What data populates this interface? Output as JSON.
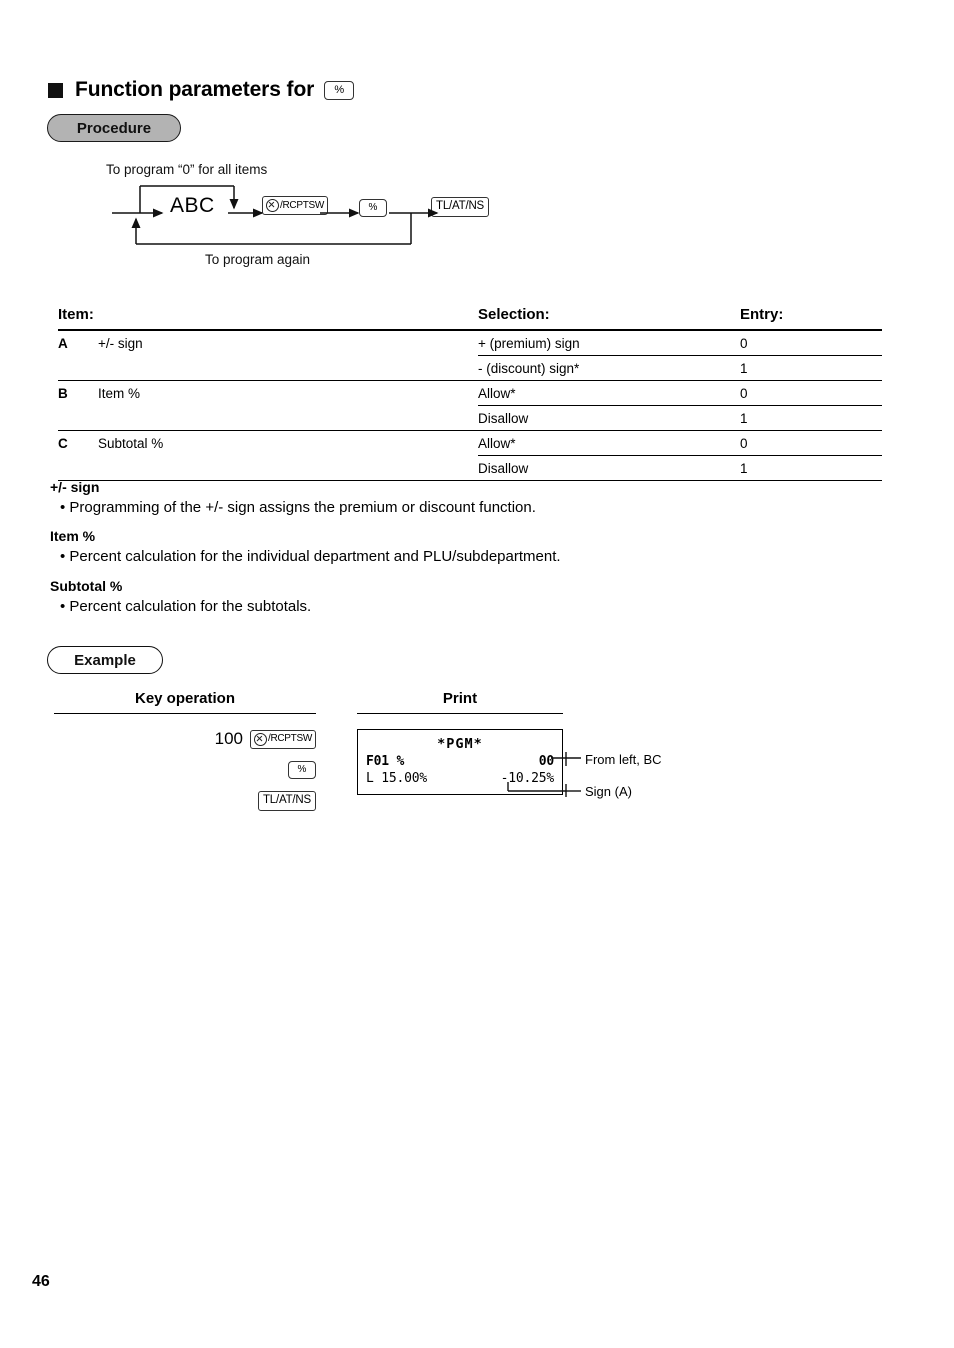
{
  "heading": {
    "marker": "■",
    "title": "Function parameters for",
    "key_icon_label": "%"
  },
  "badges": {
    "procedure": "Procedure",
    "example": "Example"
  },
  "flow": {
    "caption_top": "To program “0” for all items",
    "caption_bottom": "To program again",
    "node_abc": "ABC",
    "key_rcptsw": "/RCPTSW",
    "key_percent": "%",
    "key_total": "TL/AT/NS"
  },
  "table": {
    "headers": {
      "item": "Item:",
      "selection": "Selection:",
      "entry": "Entry:"
    },
    "groups": [
      {
        "letter": "A",
        "item": "+/- sign",
        "rows": [
          {
            "selection": "+ (premium) sign",
            "entry": "0"
          },
          {
            "selection": "- (discount) sign*",
            "entry": "1"
          }
        ]
      },
      {
        "letter": "B",
        "item": "Item %",
        "rows": [
          {
            "selection": "Allow*",
            "entry": "0"
          },
          {
            "selection": "Disallow",
            "entry": "1"
          }
        ]
      },
      {
        "letter": "C",
        "item": "Subtotal %",
        "rows": [
          {
            "selection": "Allow*",
            "entry": "0"
          },
          {
            "selection": "Disallow",
            "entry": "1"
          }
        ]
      }
    ]
  },
  "descriptions": [
    {
      "title": "+/- sign",
      "body": "• Programming of the +/- sign assigns the premium or discount function."
    },
    {
      "title": "Item %",
      "body": "• Percent calculation for the individual department and PLU/subdepartment."
    },
    {
      "title": "Subtotal %",
      "body": "• Percent calculation for the subtotals."
    }
  ],
  "example": {
    "col_head_key": "Key operation",
    "col_head_print": "Print",
    "key_operations": [
      {
        "number": "100",
        "key": "/RCPTSW"
      },
      {
        "number": "",
        "key": "%"
      },
      {
        "number": "",
        "key": "TL/AT/NS"
      }
    ],
    "receipt": {
      "title": "*PGM*",
      "line1_left": "F01 %",
      "line1_right": "00",
      "line2_left": "L 15.00%",
      "line2_right": "-10.25%"
    },
    "annotations": {
      "from_left_bc": "From left, BC",
      "sign_a": "Sign (A)"
    }
  },
  "page_number": "46"
}
